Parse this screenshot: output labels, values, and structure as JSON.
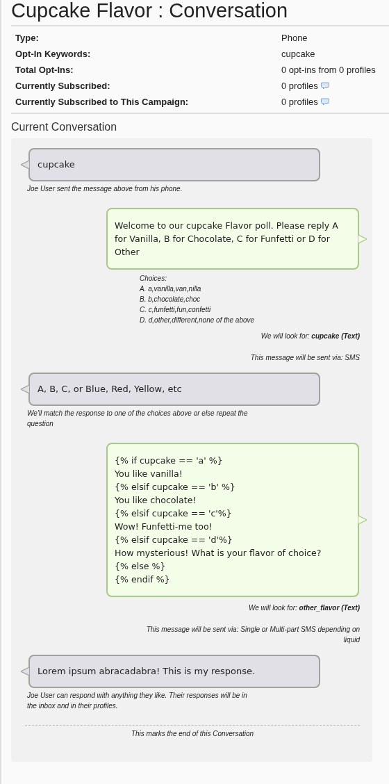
{
  "page_title": "Cupcake Flavor : Conversation",
  "details": [
    {
      "label": "Type:",
      "value": "Phone",
      "note_icon": false
    },
    {
      "label": "Opt-In Keywords:",
      "value": "cupcake",
      "note_icon": false
    },
    {
      "label": "Total Opt-Ins:",
      "value": "0 opt-ins from 0 profiles",
      "note_icon": false
    },
    {
      "label": "Currently Subscribed:",
      "value": "0 profiles",
      "note_icon": true
    },
    {
      "label": "Currently Subscribed to This Campaign:",
      "value": "0 profiles",
      "note_icon": true
    }
  ],
  "section_title": "Current Conversation",
  "messages": [
    {
      "kind": "incoming",
      "text": "cupcake",
      "note": "Joe User sent the message above from his phone."
    },
    {
      "kind": "outgoing",
      "lines": [
        "Welcome to our cupcake Flavor poll. Please reply A for Vanilla, B for Chocolate, C for Funfetti or D for Other"
      ],
      "choices": {
        "title": "Choices:",
        "items": [
          "A. a,vanilla,van,nilla",
          "B. b,chocolate,choc",
          "C. c,funfetti,fun,confetti",
          "D. d,other,different,none of the above"
        ]
      },
      "look_for": "We will look for: **cupcake (Text)**",
      "sent_via": "This message will be sent via: SMS"
    },
    {
      "kind": "incoming",
      "text": "A, B, C, or Blue, Red, Yellow, etc",
      "note": "We'll match the response to one of the choices above or else repeat the question"
    },
    {
      "kind": "outgoing",
      "lines": [
        "{% if cupcake == 'a' %}",
        "You like vanilla!",
        "{% elsif cupcake == 'b' %}",
        "You like chocolate!",
        "{% elsif cupcake == 'c'%}",
        "Wow! Funfetti-me too!",
        "{% elsif cupcake == 'd'%}",
        "How mysterious! What is your flavor of choice?",
        "{% else %}",
        "{% endif %}"
      ],
      "look_for": "We will look for: **other_flavor (Text)**",
      "sent_via": "This message will be sent via: Single or Multi-part SMS depending on liquid"
    },
    {
      "kind": "incoming",
      "text": "Lorem ipsum abracadabra! This is my response.",
      "note": "Joe User can respond with anything they like. Their responses will be in the inbox and in their profiles."
    }
  ],
  "end_note": "This marks the end of this Conversation"
}
